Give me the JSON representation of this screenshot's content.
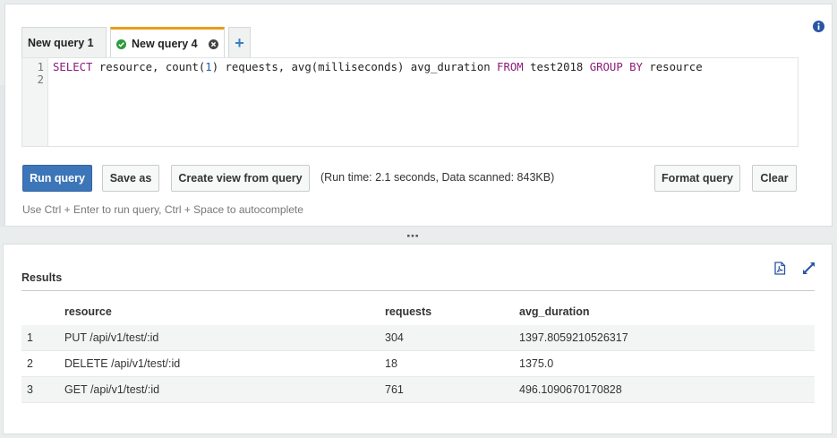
{
  "tabs": [
    {
      "label": "New query 1",
      "active": false
    },
    {
      "label": "New query 4",
      "active": true,
      "status": "check-circle-icon"
    }
  ],
  "add_tab_label": "+",
  "editor": {
    "line_numbers": [
      "1",
      "2"
    ],
    "sql": {
      "t1": "SELECT",
      "t2": " resource, count(",
      "t3": "1",
      "t4": ") requests, avg(milliseconds) avg_duration ",
      "t5": "FROM",
      "t6": " test2018 ",
      "t7": "GROUP",
      "t8": " ",
      "t9": "BY",
      "t10": " resource"
    }
  },
  "toolbar": {
    "run_label": "Run query",
    "save_label": "Save as",
    "view_label": "Create view from query",
    "runtime": "(Run time: 2.1 seconds, Data scanned: 843KB)",
    "format_label": "Format query",
    "clear_label": "Clear"
  },
  "hint": "Use Ctrl + Enter to run query, Ctrl + Space to autocomplete",
  "results": {
    "title": "Results",
    "columns": [
      "",
      "resource",
      "requests",
      "avg_duration"
    ],
    "rows": [
      [
        "1",
        "PUT /api/v1/test/:id",
        "304",
        "1397.8059210526317"
      ],
      [
        "2",
        "DELETE /api/v1/test/:id",
        "18",
        "1375.0"
      ],
      [
        "3",
        "GET /api/v1/test/:id",
        "761",
        "496.1090670170828"
      ]
    ]
  },
  "colors": {
    "accent_tab": "#ec9b19",
    "primary_button": "#3d76b8",
    "sql_keyword": "#8b1b7a",
    "sql_number": "#1a5fb4",
    "icon_blue": "#2a55a5"
  }
}
